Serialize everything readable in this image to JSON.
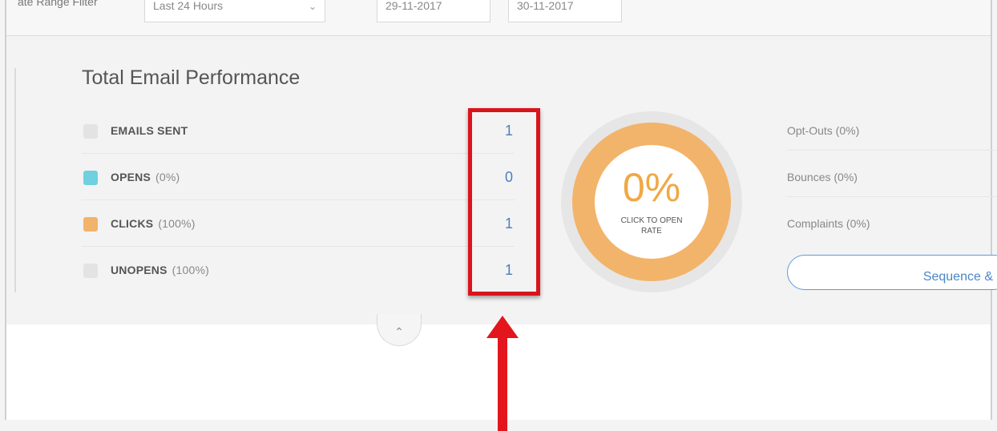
{
  "filter_bar": {
    "label": "ate Range Filter",
    "range_value": "Last 24 Hours",
    "start_date": "29-11-2017",
    "end_date": "30-11-2017",
    "extra": ""
  },
  "panel": {
    "title": "Total Email Performance",
    "metrics": [
      {
        "name": "EMAILS SENT",
        "pct": "",
        "value": "1",
        "swatch_color": "#e3e3e3"
      },
      {
        "name": "OPENS",
        "pct": "(0%)",
        "value": "0",
        "swatch_color": "#6fd0e0"
      },
      {
        "name": "CLICKS",
        "pct": "(100%)",
        "value": "1",
        "swatch_color": "#f2b46a"
      },
      {
        "name": "UNOPENS",
        "pct": "(100%)",
        "value": "1",
        "swatch_color": "#e3e3e3"
      }
    ],
    "donut": {
      "percent": "0%",
      "label": "CLICK TO OPEN RATE",
      "percent_value": 0,
      "ring_color": "#f2b46a"
    },
    "right_stats": {
      "opt_outs": "Opt-Outs (0%)",
      "bounces": "Bounces (0%)",
      "complaints": "Complaints (0%)"
    },
    "sequence_button": "Sequence &"
  },
  "collapse_icon": "chevron-up-icon",
  "annotation": {
    "highlight_color": "#d9141c",
    "arrow_color": "#e3161d"
  }
}
